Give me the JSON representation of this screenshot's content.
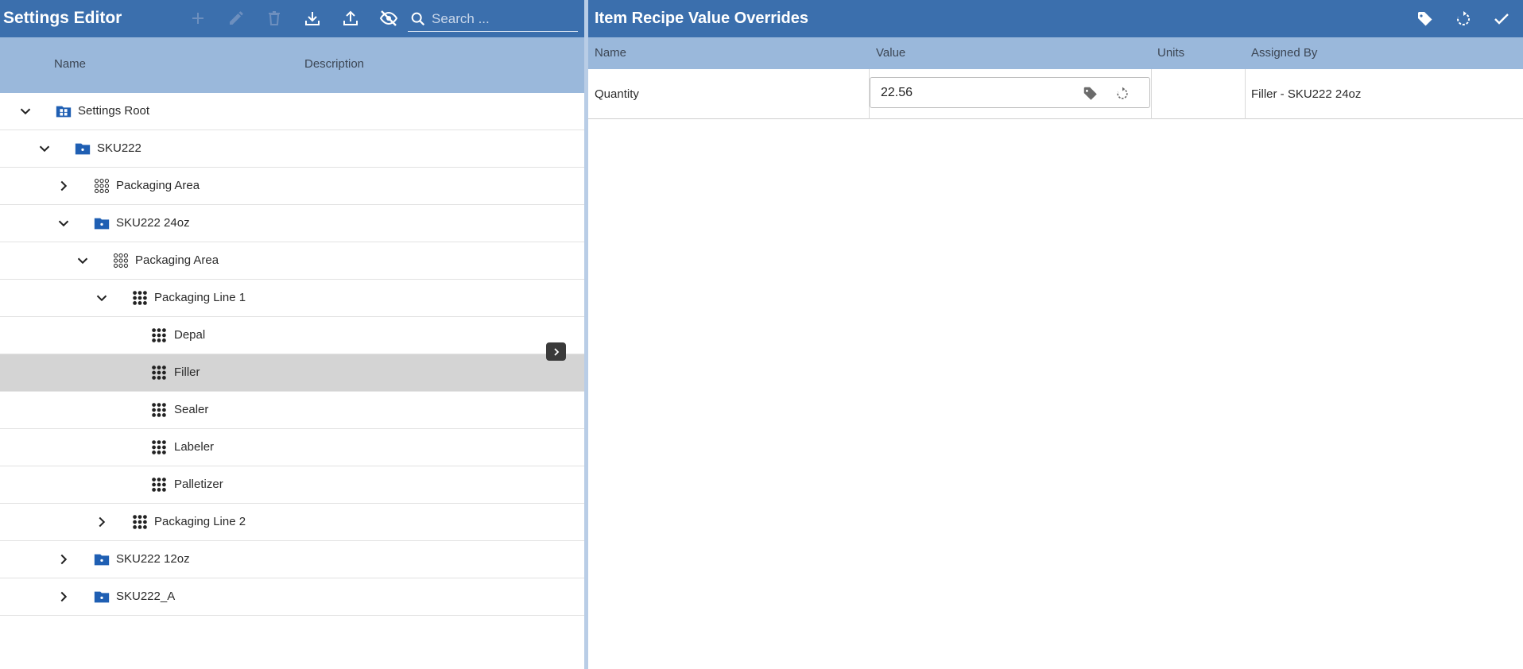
{
  "app": {
    "title": "Settings Editor",
    "search_placeholder": "Search ...",
    "toolbar_icons": [
      "add-icon",
      "edit-icon",
      "delete-icon",
      "download-icon",
      "upload-icon",
      "visibility-off-icon"
    ]
  },
  "tree": {
    "columns": {
      "name": "Name",
      "description": "Description"
    },
    "nodes": [
      {
        "label": "Settings Root",
        "icon": "settings-root-icon",
        "expanded": true
      },
      {
        "label": "SKU222",
        "icon": "folder-icon",
        "expanded": true
      },
      {
        "label": "Packaging Area",
        "icon": "area-grid-icon",
        "expanded": false
      },
      {
        "label": "SKU222 24oz",
        "icon": "folder-icon",
        "expanded": true
      },
      {
        "label": "Packaging Area",
        "icon": "area-grid-icon",
        "expanded": true
      },
      {
        "label": "Packaging Line 1",
        "icon": "line-grid-icon",
        "expanded": true
      },
      {
        "label": "Depal",
        "icon": "line-grid-icon"
      },
      {
        "label": "Filler",
        "icon": "line-grid-icon",
        "selected": true
      },
      {
        "label": "Sealer",
        "icon": "line-grid-icon"
      },
      {
        "label": "Labeler",
        "icon": "line-grid-icon"
      },
      {
        "label": "Palletizer",
        "icon": "line-grid-icon"
      },
      {
        "label": "Packaging Line 2",
        "icon": "line-grid-icon",
        "expanded": false
      },
      {
        "label": "SKU222 12oz",
        "icon": "folder-icon",
        "expanded": false
      },
      {
        "label": "SKU222_A",
        "icon": "folder-icon",
        "expanded": false
      }
    ]
  },
  "overrides": {
    "title": "Item Recipe Value Overrides",
    "header_icons": [
      "tag-icon",
      "reset-icon",
      "check-icon"
    ],
    "columns": {
      "name": "Name",
      "value": "Value",
      "units": "Units",
      "assigned_by": "Assigned By"
    },
    "rows": [
      {
        "name": "Quantity",
        "value": "22.56",
        "units": "",
        "assigned_by": "Filler - SKU222 24oz"
      }
    ]
  },
  "colors": {
    "header_bg": "#3b6fad",
    "subheader_bg": "#9ab8db",
    "folder_icon": "#1f5fb3",
    "selected_row": "#d4d4d4"
  }
}
